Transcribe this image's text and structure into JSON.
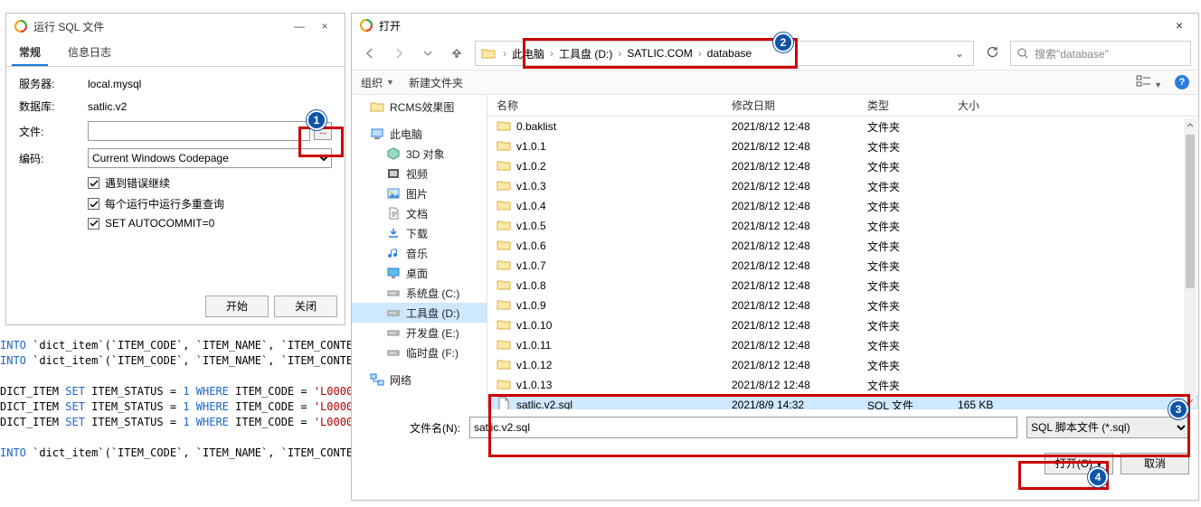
{
  "run_dialog": {
    "title": "运行 SQL 文件",
    "win_min": "—",
    "win_close": "×",
    "tab_general": "常规",
    "tab_log": "信息日志",
    "label_server": "服务器:",
    "value_server": "local.mysql",
    "label_database": "数据库:",
    "value_database": "satlic.v2",
    "label_file": "文件:",
    "value_file": "",
    "browse": "...",
    "label_encoding": "编码:",
    "value_encoding": "Current Windows Codepage",
    "chk_continue": "遇到错误继续",
    "chk_multi": "每个运行中运行多重查询",
    "chk_autocommit": "SET AUTOCOMMIT=0",
    "btn_start": "开始",
    "btn_close": "关闭"
  },
  "code": "INTO `dict_item`(`ITEM_CODE`, `ITEM_NAME`, `ITEM_CONTE\nINTO `dict_item`(`ITEM_CODE`, `ITEM_NAME`, `ITEM_CONTE\n\nDICT_ITEM SET ITEM_STATUS = 1 WHERE ITEM_CODE = 'L0000\nDICT_ITEM SET ITEM_STATUS = 1 WHERE ITEM_CODE = 'L0000\nDICT_ITEM SET ITEM_STATUS = 1 WHERE ITEM_CODE = 'L0000\n\nINTO `dict_item`(`ITEM_CODE`, `ITEM_NAME`, `ITEM_CONTE",
  "open_dialog": {
    "title": "打开",
    "close_glyph": "×",
    "back": "←",
    "forward": "→",
    "up": "↑",
    "crumbs": [
      "此电脑",
      "工具盘 (D:)",
      "SATLIC.COM",
      "database"
    ],
    "crumb_dd": "⌄",
    "refresh": "⟳",
    "search_placeholder": "搜索\"database\"",
    "organize": "组织",
    "new_folder": "新建文件夹",
    "tree": {
      "top": "RCMS效果图",
      "this_pc": "此电脑",
      "children": [
        "3D 对象",
        "视频",
        "图片",
        "文档",
        "下载",
        "音乐",
        "桌面",
        "系统盘 (C:)",
        "工具盘 (D:)",
        "开发盘 (E:)",
        "临时盘 (F:)"
      ],
      "network": "网络"
    },
    "columns": {
      "name": "名称",
      "date": "修改日期",
      "type": "类型",
      "size": "大小"
    },
    "rows": [
      {
        "name": "0.baklist",
        "date": "2021/8/12 12:48",
        "type": "文件夹",
        "size": "",
        "folder": true
      },
      {
        "name": "v1.0.1",
        "date": "2021/8/12 12:48",
        "type": "文件夹",
        "size": "",
        "folder": true
      },
      {
        "name": "v1.0.2",
        "date": "2021/8/12 12:48",
        "type": "文件夹",
        "size": "",
        "folder": true
      },
      {
        "name": "v1.0.3",
        "date": "2021/8/12 12:48",
        "type": "文件夹",
        "size": "",
        "folder": true
      },
      {
        "name": "v1.0.4",
        "date": "2021/8/12 12:48",
        "type": "文件夹",
        "size": "",
        "folder": true
      },
      {
        "name": "v1.0.5",
        "date": "2021/8/12 12:48",
        "type": "文件夹",
        "size": "",
        "folder": true
      },
      {
        "name": "v1.0.6",
        "date": "2021/8/12 12:48",
        "type": "文件夹",
        "size": "",
        "folder": true
      },
      {
        "name": "v1.0.7",
        "date": "2021/8/12 12:48",
        "type": "文件夹",
        "size": "",
        "folder": true
      },
      {
        "name": "v1.0.8",
        "date": "2021/8/12 12:48",
        "type": "文件夹",
        "size": "",
        "folder": true
      },
      {
        "name": "v1.0.9",
        "date": "2021/8/12 12:48",
        "type": "文件夹",
        "size": "",
        "folder": true
      },
      {
        "name": "v1.0.10",
        "date": "2021/8/12 12:48",
        "type": "文件夹",
        "size": "",
        "folder": true
      },
      {
        "name": "v1.0.11",
        "date": "2021/8/12 12:48",
        "type": "文件夹",
        "size": "",
        "folder": true
      },
      {
        "name": "v1.0.12",
        "date": "2021/8/12 12:48",
        "type": "文件夹",
        "size": "",
        "folder": true
      },
      {
        "name": "v1.0.13",
        "date": "2021/8/12 12:48",
        "type": "文件夹",
        "size": "",
        "folder": true
      },
      {
        "name": "satlic.v2.sql",
        "date": "2021/8/9 14:32",
        "type": "SQL 文件",
        "size": "165 KB",
        "folder": false,
        "selected": true
      }
    ],
    "filename_label": "文件名(N):",
    "filename_value": "satlic.v2.sql",
    "filter_value": "SQL 脚本文件 (*.sql)",
    "btn_open": "打开(O)",
    "btn_cancel": "取消"
  },
  "badges": {
    "b1": "1",
    "b2": "2",
    "b3": "3",
    "b4": "4"
  }
}
